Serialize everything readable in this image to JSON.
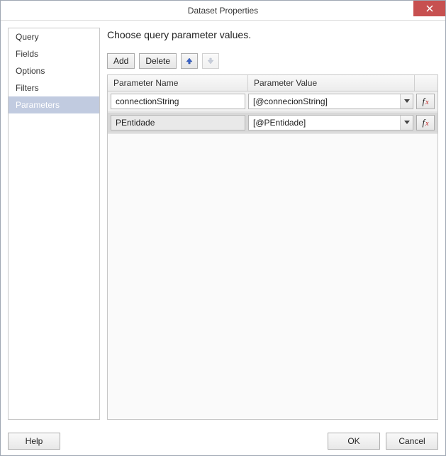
{
  "window": {
    "title": "Dataset Properties"
  },
  "sidebar": {
    "items": [
      {
        "label": "Query",
        "selected": false
      },
      {
        "label": "Fields",
        "selected": false
      },
      {
        "label": "Options",
        "selected": false
      },
      {
        "label": "Filters",
        "selected": false
      },
      {
        "label": "Parameters",
        "selected": true
      }
    ]
  },
  "content": {
    "heading": "Choose query parameter values.",
    "toolbar": {
      "add_label": "Add",
      "delete_label": "Delete",
      "move_up_icon": "arrow-up",
      "move_down_icon": "arrow-down"
    },
    "grid": {
      "columns": {
        "name": "Parameter Name",
        "value": "Parameter Value"
      },
      "rows": [
        {
          "name": "connectionString",
          "value": "[@connecionString]",
          "selected": false
        },
        {
          "name": "PEntidade",
          "value": "[@PEntidade]",
          "selected": true
        }
      ]
    }
  },
  "footer": {
    "help_label": "Help",
    "ok_label": "OK",
    "cancel_label": "Cancel"
  }
}
